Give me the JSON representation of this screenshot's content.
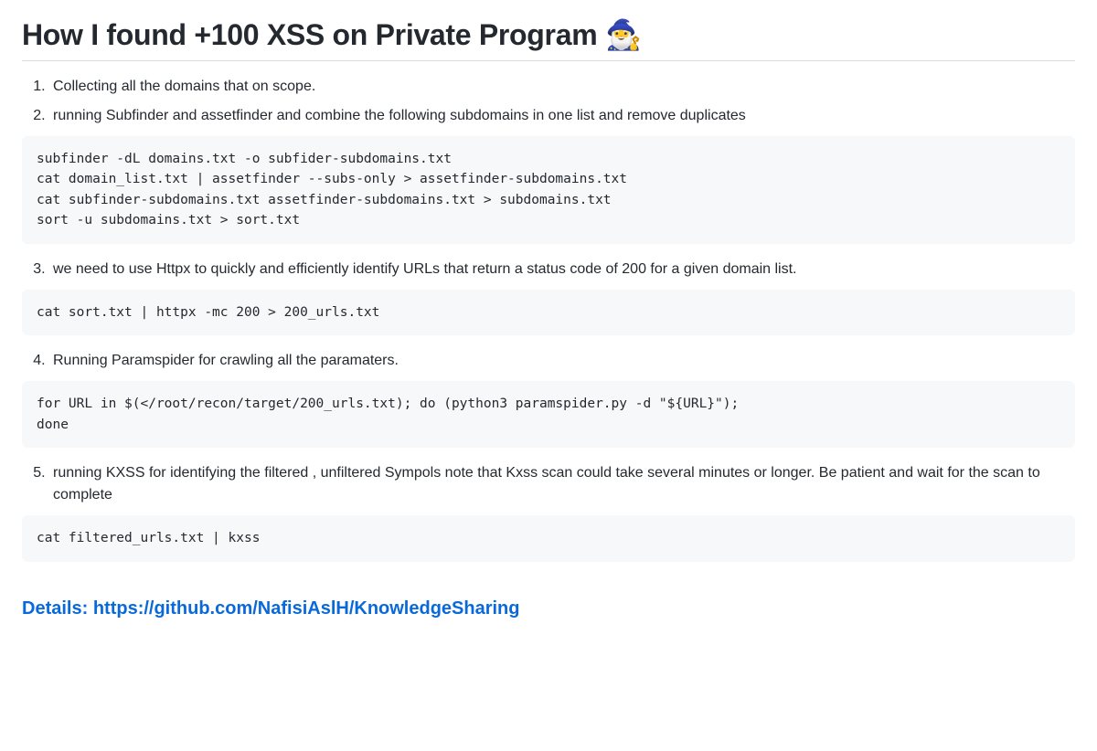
{
  "title": "How I found +100 XSS on Private Program 🧙‍♂️",
  "steps": [
    {
      "text": "Collecting all the domains that on scope."
    },
    {
      "text": "running Subfinder and assetfinder and combine the following subdomains in one list and remove duplicates"
    }
  ],
  "code1": "subfinder -dL domains.txt -o subfider-subdomains.txt\ncat domain_list.txt | assetfinder --subs-only > assetfinder-subdomains.txt\ncat subfinder-subdomains.txt assetfinder-subdomains.txt > subdomains.txt\nsort -u subdomains.txt > sort.txt",
  "step3": "we need to use Httpx to quickly and efficiently identify URLs that return a status code of 200 for a given domain list.",
  "code2": "cat sort.txt | httpx -mc 200 > 200_urls.txt",
  "step4": "Running Paramspider for crawling all the paramaters.",
  "code3": "for URL in $(</root/recon/target/200_urls.txt); do (python3 paramspider.py -d \"${URL}\");\ndone",
  "step5": "running KXSS for identifying the filtered , unfiltered Sympols note that Kxss scan could take several minutes or longer. Be patient and wait for the scan to complete",
  "code4": "cat filtered_urls.txt | kxss",
  "details_label": "Details: ",
  "details_url": "https://github.com/NafisiAslH/KnowledgeSharing"
}
